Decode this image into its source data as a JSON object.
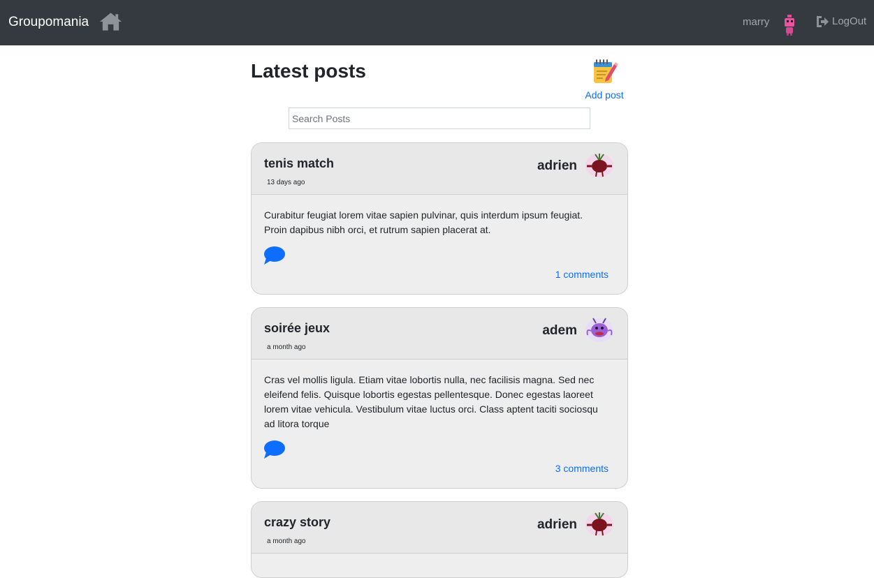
{
  "navbar": {
    "brand": "Groupomania",
    "user_name": "marry",
    "logout_label": "LogOut"
  },
  "header": {
    "title": "Latest posts",
    "add_post_label": "Add post"
  },
  "search": {
    "placeholder": "Search Posts"
  },
  "posts": [
    {
      "title": "tenis match",
      "time": "13 days ago",
      "author": "adrien",
      "text": "Curabitur feugiat lorem vitae sapien pulvinar, quis interdum ipsum feugiat. Proin dapibus nibh orci, et rutrum sapien placerat at.",
      "comments": "1 comments"
    },
    {
      "title": "soirée jeux",
      "time": "a month ago",
      "author": "adem",
      "text": "Cras vel mollis ligula. Etiam vitae lobortis nulla, nec facilisis magna. Sed nec eleifend felis. Quisque lobortis egestas pellentesque. Donec egestas laoreet lorem vitae vehicula. Vestibulum vitae luctus orci. Class aptent taciti sociosqu ad litora torque",
      "comments": "3 comments"
    },
    {
      "title": "crazy story",
      "time": "a month ago",
      "author": "adrien"
    }
  ],
  "colors": {
    "navbar": "#343a40",
    "link": "#0d6efd",
    "comment_icon": "#0d6efd",
    "card_bg": "#eeeeee"
  }
}
